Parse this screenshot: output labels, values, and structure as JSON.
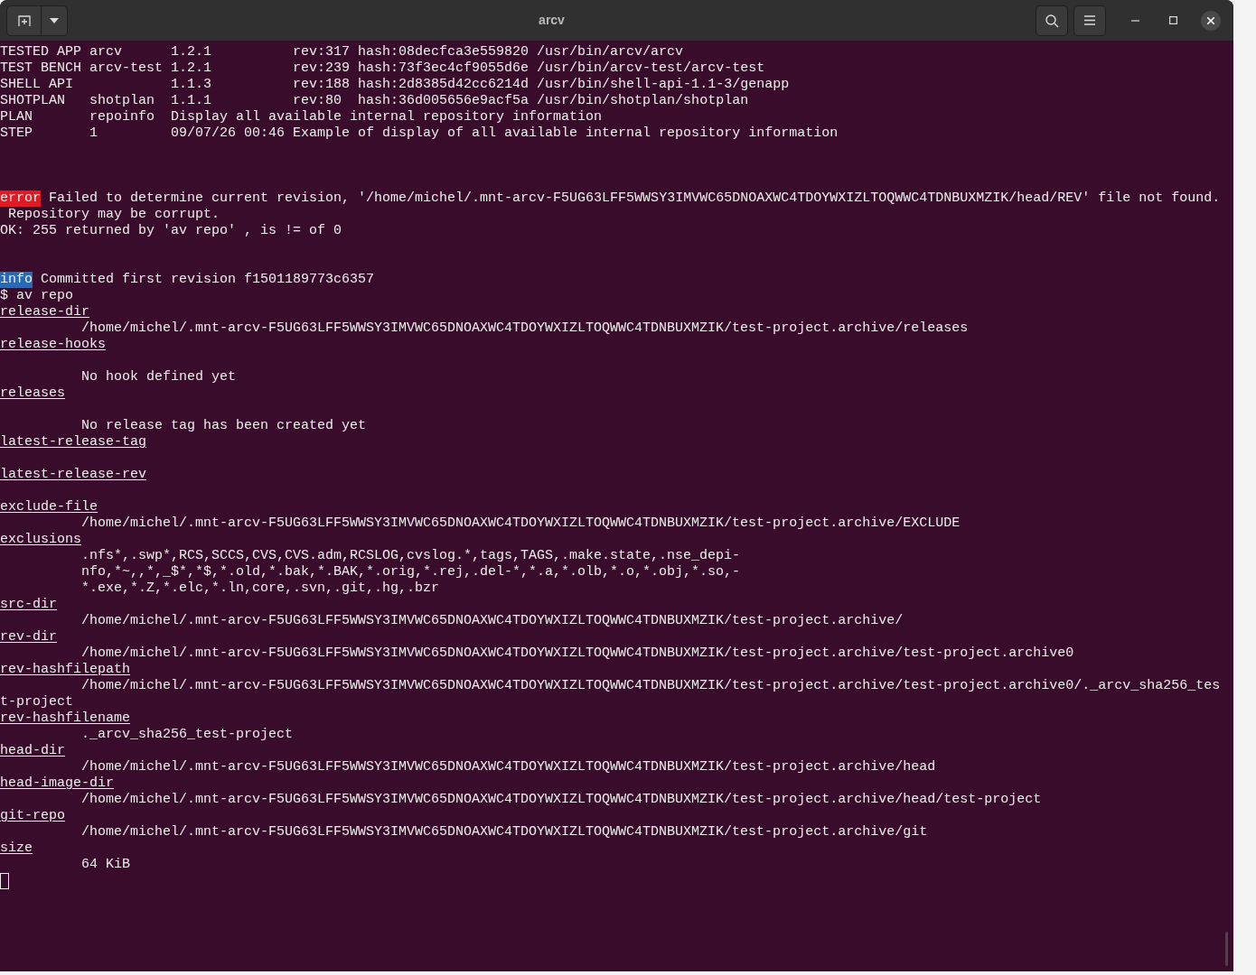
{
  "window": {
    "title": "arcv"
  },
  "lines": [
    {
      "kind": "text",
      "text": "TESTED APP arcv      1.2.1          rev:317 hash:08decfca3e559820 /usr/bin/arcv/arcv"
    },
    {
      "kind": "text",
      "text": "TEST BENCH arcv-test 1.2.1          rev:239 hash:73f3ec4cf9055d6e /usr/bin/arcv-test/arcv-test"
    },
    {
      "kind": "text",
      "text": "SHELL API            1.1.3          rev:188 hash:2d8385d42cc6214d /usr/bin/shell-api-1.1-3/genapp"
    },
    {
      "kind": "text",
      "text": "SHOTPLAN   shotplan  1.1.1          rev:80  hash:36d005656e9acf5a /usr/bin/shotplan/shotplan"
    },
    {
      "kind": "text",
      "text": "PLAN       repoinfo  Display all available internal repository information"
    },
    {
      "kind": "text",
      "text": "STEP       1         09/07/26 00:46 Example of display of all available internal repository information"
    },
    {
      "kind": "blank"
    },
    {
      "kind": "blank"
    },
    {
      "kind": "blank"
    },
    {
      "kind": "error",
      "tag": "error",
      "text": "Failed to determine current revision, '/home/michel/.mnt-arcv-F5UG63LFF5WWSY3IMVWC65DNOAXWC4TDOYWXIZLTOQWWC4TDNBUXMZIK/head/REV' file not found."
    },
    {
      "kind": "text",
      "text": " Repository may be corrupt."
    },
    {
      "kind": "text",
      "text": "OK: 255 returned by 'av repo' , is != of 0"
    },
    {
      "kind": "blank"
    },
    {
      "kind": "blank"
    },
    {
      "kind": "info",
      "tag": "info",
      "text": "Committed first revision f1501189773c6357"
    },
    {
      "kind": "text",
      "text": "$ av repo"
    },
    {
      "kind": "key",
      "text": "release-dir"
    },
    {
      "kind": "value",
      "text": "/home/michel/.mnt-arcv-F5UG63LFF5WWSY3IMVWC65DNOAXWC4TDOYWXIZLTOQWWC4TDNBUXMZIK/test-project.archive/releases"
    },
    {
      "kind": "key",
      "text": "release-hooks"
    },
    {
      "kind": "blank"
    },
    {
      "kind": "value",
      "text": "No hook defined yet"
    },
    {
      "kind": "key",
      "text": "releases"
    },
    {
      "kind": "blank"
    },
    {
      "kind": "value",
      "text": "No release tag has been created yet"
    },
    {
      "kind": "key",
      "text": "latest-release-tag"
    },
    {
      "kind": "blank"
    },
    {
      "kind": "key",
      "text": "latest-release-rev"
    },
    {
      "kind": "blank"
    },
    {
      "kind": "key",
      "text": "exclude-file"
    },
    {
      "kind": "value",
      "text": "/home/michel/.mnt-arcv-F5UG63LFF5WWSY3IMVWC65DNOAXWC4TDOYWXIZLTOQWWC4TDNBUXMZIK/test-project.archive/EXCLUDE"
    },
    {
      "kind": "key",
      "text": "exclusions"
    },
    {
      "kind": "value",
      "text": ".nfs*,.swp*,RCS,SCCS,CVS,CVS.adm,RCSLOG,cvslog.*,tags,TAGS,.make.state,.nse_depi-"
    },
    {
      "kind": "value",
      "text": "nfo,*~,,*,_$*,*$,*.old,*.bak,*.BAK,*.orig,*.rej,.del-*,*.a,*.olb,*.o,*.obj,*.so,-"
    },
    {
      "kind": "value",
      "text": "*.exe,*.Z,*.elc,*.ln,core,.svn,.git,.hg,.bzr"
    },
    {
      "kind": "key",
      "text": "src-dir"
    },
    {
      "kind": "value",
      "text": "/home/michel/.mnt-arcv-F5UG63LFF5WWSY3IMVWC65DNOAXWC4TDOYWXIZLTOQWWC4TDNBUXMZIK/test-project.archive/"
    },
    {
      "kind": "key",
      "text": "rev-dir"
    },
    {
      "kind": "value",
      "text": "/home/michel/.mnt-arcv-F5UG63LFF5WWSY3IMVWC65DNOAXWC4TDOYWXIZLTOQWWC4TDNBUXMZIK/test-project.archive/test-project.archive0"
    },
    {
      "kind": "key",
      "text": "rev-hashfilepath"
    },
    {
      "kind": "value",
      "text": "/home/michel/.mnt-arcv-F5UG63LFF5WWSY3IMVWC65DNOAXWC4TDOYWXIZLTOQWWC4TDNBUXMZIK/test-project.archive/test-project.archive0/._arcv_sha256_tes"
    },
    {
      "kind": "text",
      "text": "t-project"
    },
    {
      "kind": "key",
      "text": "rev-hashfilename"
    },
    {
      "kind": "value",
      "text": "._arcv_sha256_test-project"
    },
    {
      "kind": "key",
      "text": "head-dir"
    },
    {
      "kind": "value",
      "text": "/home/michel/.mnt-arcv-F5UG63LFF5WWSY3IMVWC65DNOAXWC4TDOYWXIZLTOQWWC4TDNBUXMZIK/test-project.archive/head"
    },
    {
      "kind": "key",
      "text": "head-image-dir"
    },
    {
      "kind": "value",
      "text": "/home/michel/.mnt-arcv-F5UG63LFF5WWSY3IMVWC65DNOAXWC4TDOYWXIZLTOQWWC4TDNBUXMZIK/test-project.archive/head/test-project"
    },
    {
      "kind": "key",
      "text": "git-repo"
    },
    {
      "kind": "value",
      "text": "/home/michel/.mnt-arcv-F5UG63LFF5WWSY3IMVWC65DNOAXWC4TDOYWXIZLTOQWWC4TDNBUXMZIK/test-project.archive/git"
    },
    {
      "kind": "key",
      "text": "size"
    },
    {
      "kind": "value",
      "text": "64 KiB"
    },
    {
      "kind": "cursor"
    }
  ]
}
